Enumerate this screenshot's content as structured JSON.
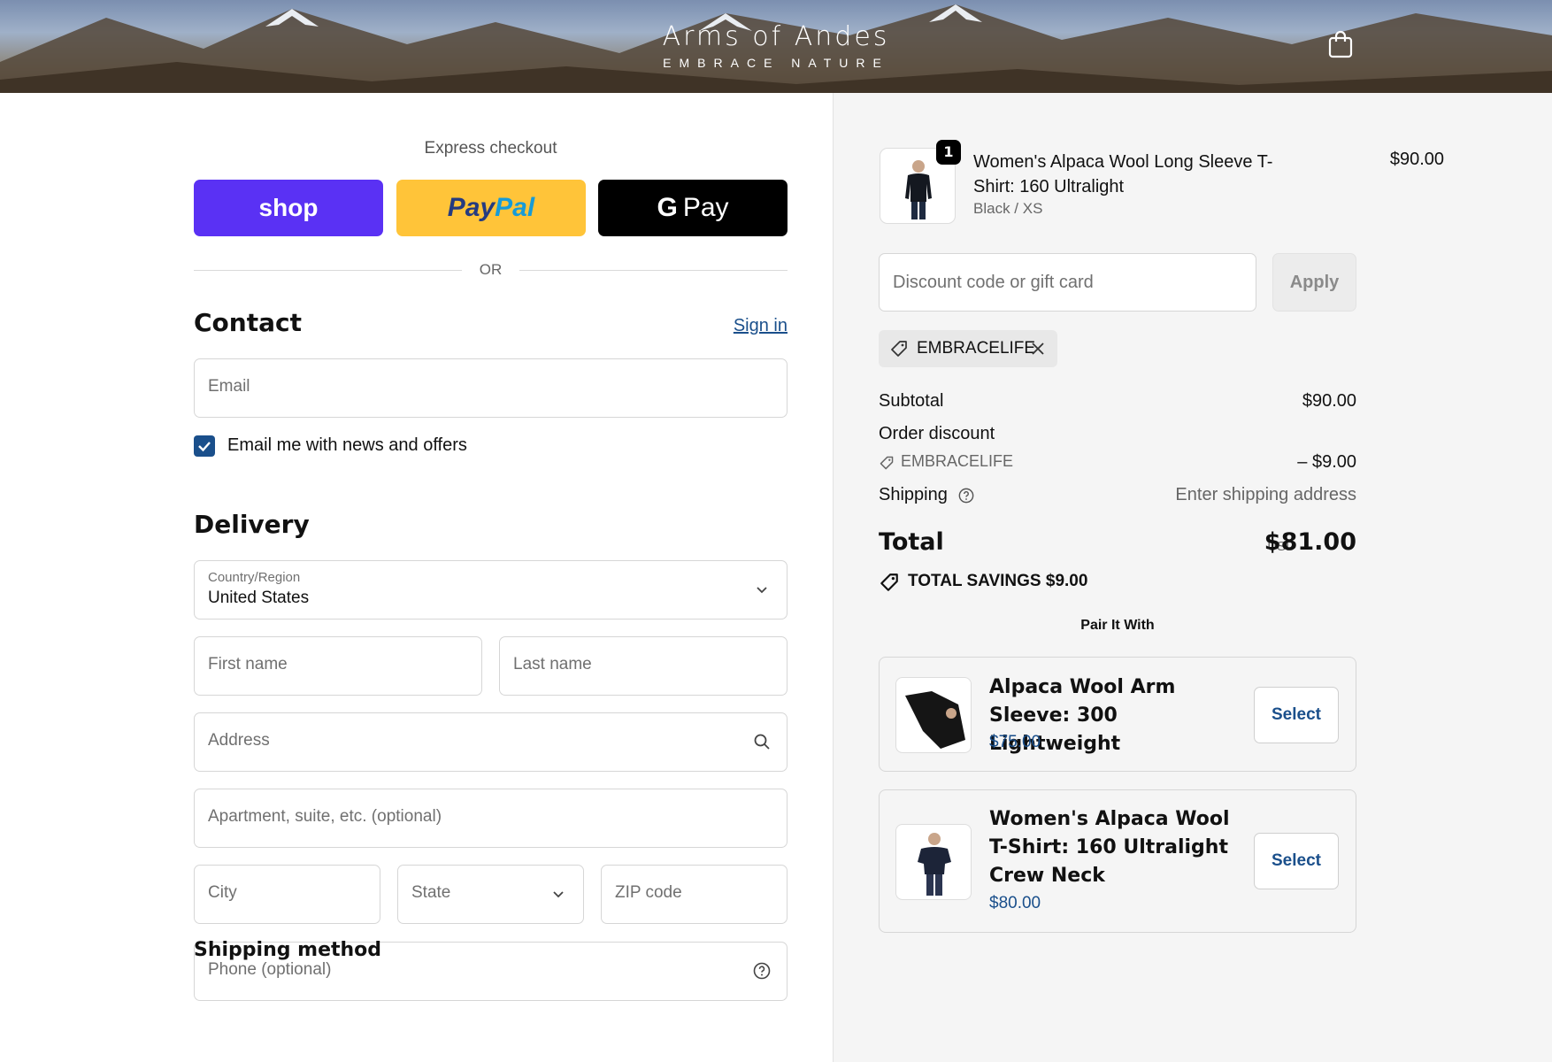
{
  "header": {
    "brand_name": "Arms of Andes",
    "brand_tagline": "EMBRACE NATURE"
  },
  "express": {
    "title": "Express checkout",
    "shop_label": "shop",
    "paypal_label_1": "Pay",
    "paypal_label_2": "Pal",
    "gpay_g": "G",
    "gpay_label": "Pay",
    "or_label": "OR"
  },
  "contact": {
    "heading": "Contact",
    "sign_in": "Sign in",
    "email_placeholder": "Email",
    "newsletter_label": "Email me with news and offers",
    "newsletter_checked": true
  },
  "delivery": {
    "heading": "Delivery",
    "country_label": "Country/Region",
    "country_value": "United States",
    "first_name": "First name",
    "last_name": "Last name",
    "address": "Address",
    "apartment": "Apartment, suite, etc. (optional)",
    "city": "City",
    "state": "State",
    "zip": "ZIP code",
    "phone": "Phone (optional)"
  },
  "shipping_method": {
    "heading": "Shipping method"
  },
  "order": {
    "item": {
      "quantity": "1",
      "name": "Women's Alpaca Wool Long Sleeve T-Shirt: 160 Ultralight",
      "variant": "Black / XS",
      "price": "$90.00"
    },
    "discount_placeholder": "Discount code or gift card",
    "apply_label": "Apply",
    "applied_code": "EMBRACELIFE",
    "subtotal_label": "Subtotal",
    "subtotal_value": "$90.00",
    "order_discount_label": "Order discount",
    "discount_code": "EMBRACELIFE",
    "discount_value": "– $9.00",
    "shipping_label": "Shipping",
    "shipping_value": "Enter shipping address",
    "total_label": "Total",
    "total_currency": "USD",
    "total_value": "$81.00",
    "savings": "TOTAL SAVINGS  $9.00"
  },
  "upsell": {
    "heading": "Pair It With",
    "items": [
      {
        "name": "Alpaca Wool Arm Sleeve: 300 Lightweight",
        "price": "$75.00",
        "button": "Select"
      },
      {
        "name": "Women's Alpaca Wool T-Shirt: 160 Ultralight Crew Neck",
        "price": "$80.00",
        "button": "Select"
      }
    ]
  },
  "colors": {
    "accent": "#1a4f8b",
    "shop_pay": "#5a31f4",
    "paypal": "#ffc439",
    "gpay": "#000000",
    "summary_bg": "#f5f5f5"
  }
}
